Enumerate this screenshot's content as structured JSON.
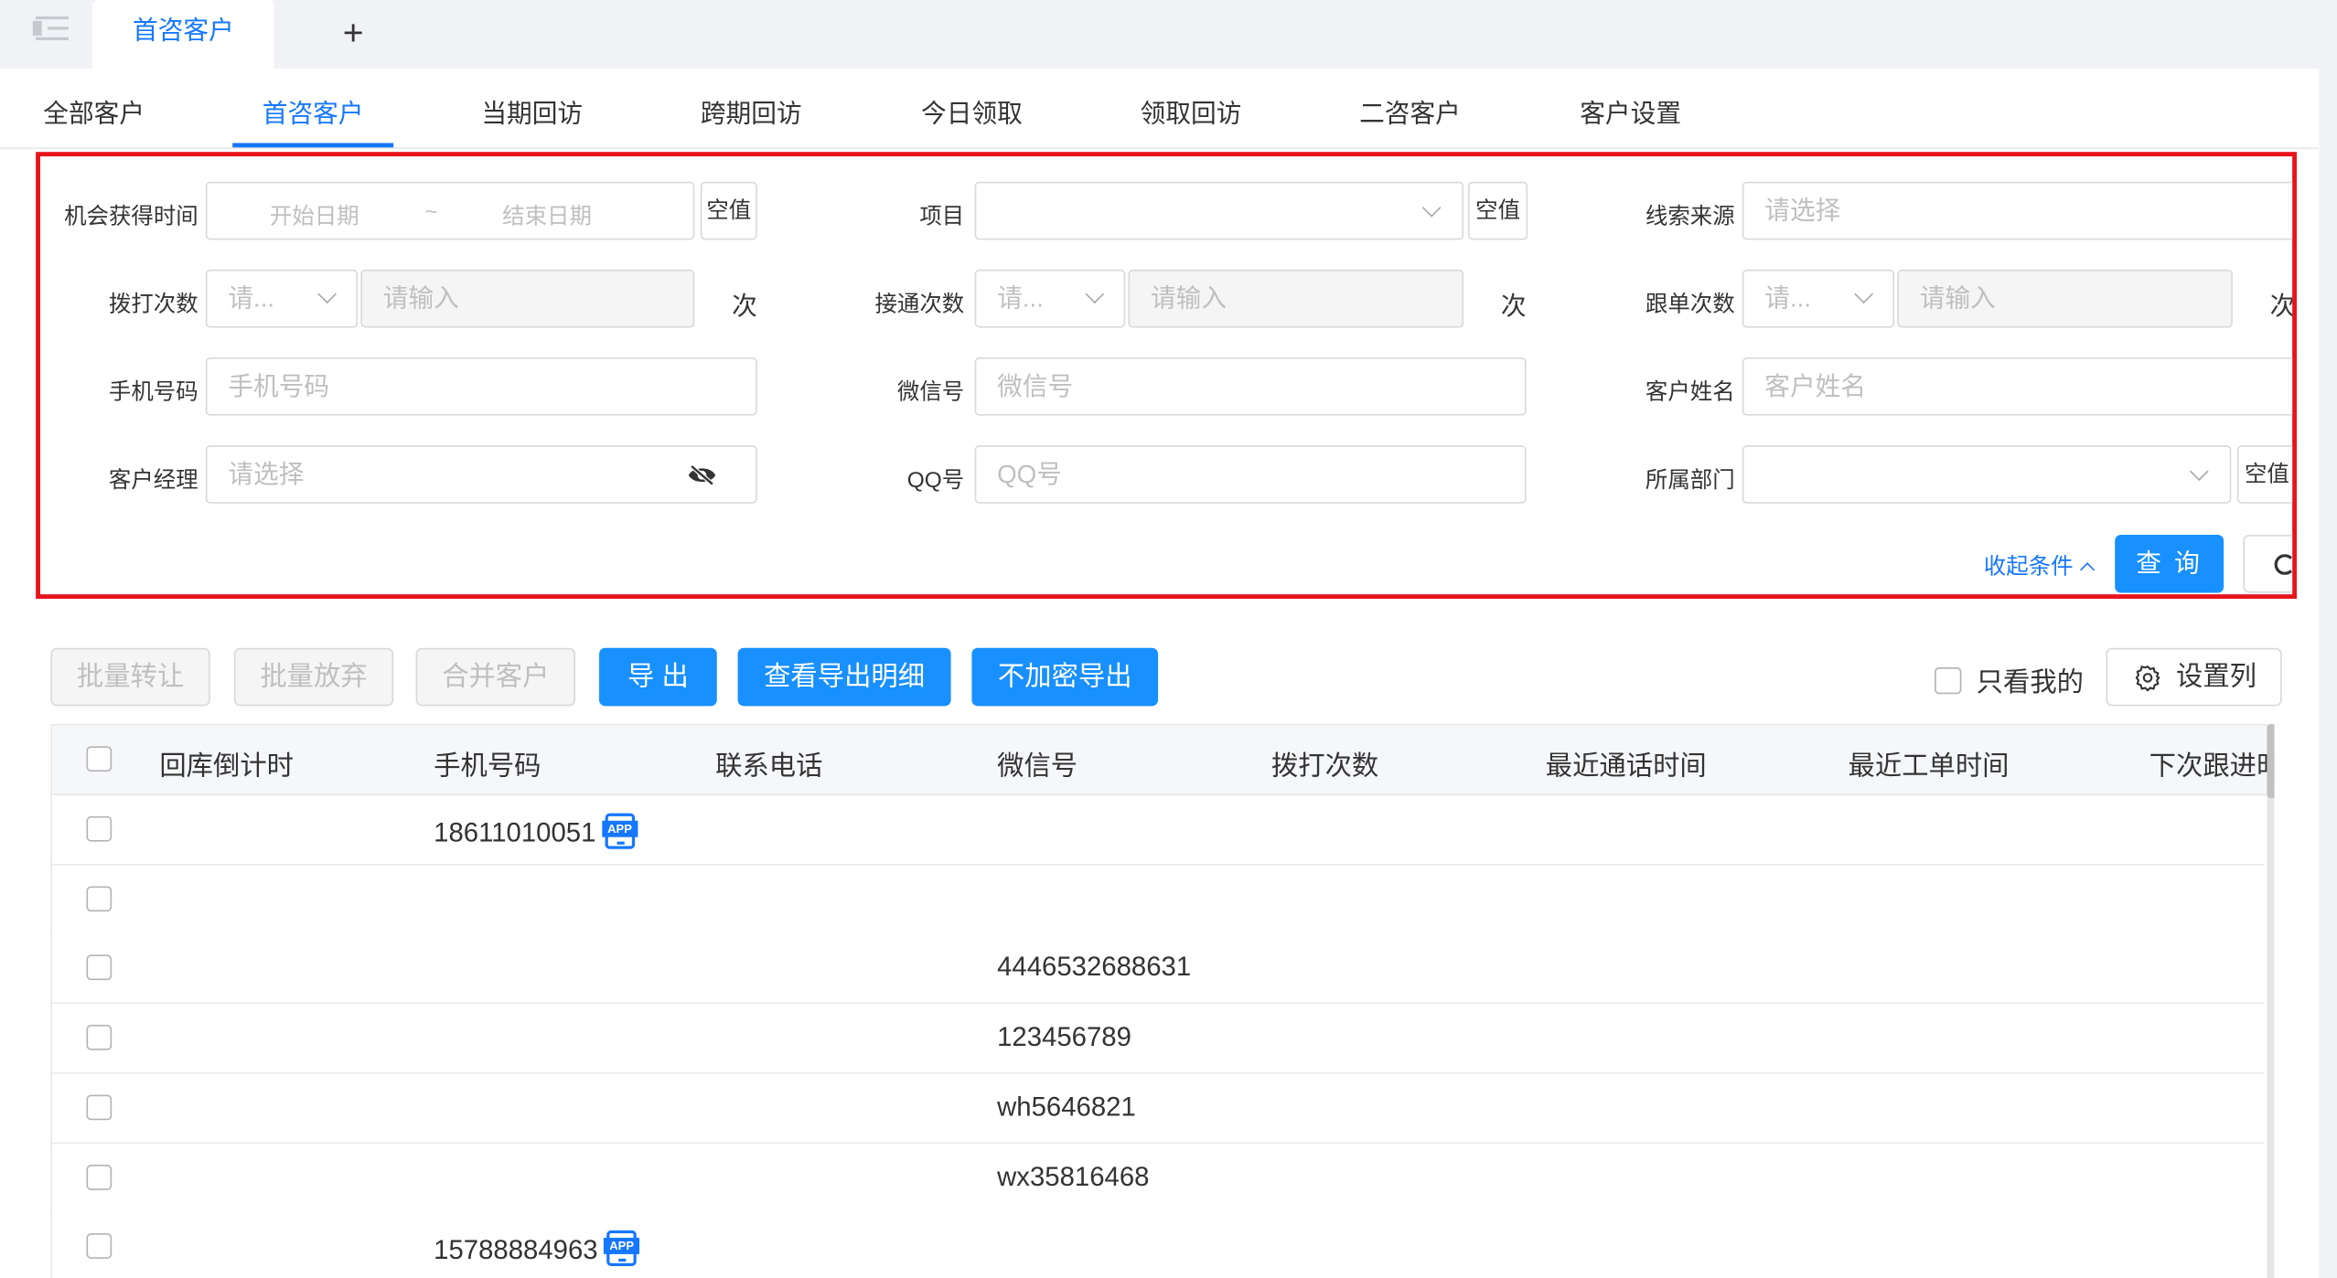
{
  "page_tabs": [
    {
      "label": "首咨客户"
    }
  ],
  "sub_tabs": [
    "全部客户",
    "首咨客户",
    "当期回访",
    "跨期回访",
    "今日领取",
    "领取回访",
    "二咨客户",
    "客户设置"
  ],
  "filters": {
    "opportunity_time": {
      "label": "机会获得时间",
      "start_placeholder": "开始日期",
      "separator": "~",
      "end_placeholder": "结束日期",
      "empty_btn": "空值"
    },
    "project": {
      "label": "项目",
      "value": "",
      "empty_btn": "空值"
    },
    "lead_source": {
      "label": "线索来源",
      "placeholder": "请选择"
    },
    "dial_count": {
      "label": "拨打次数",
      "op_placeholder": "请...",
      "placeholder": "请输入",
      "unit": "次"
    },
    "connect_count": {
      "label": "接通次数",
      "op_placeholder": "请...",
      "placeholder": "请输入",
      "unit": "次"
    },
    "follow_count": {
      "label": "跟单次数",
      "op_placeholder": "请...",
      "placeholder": "请输入",
      "unit": "次"
    },
    "phone": {
      "label": "手机号码",
      "placeholder": "手机号码"
    },
    "wechat": {
      "label": "微信号",
      "placeholder": "微信号"
    },
    "customer_name": {
      "label": "客户姓名",
      "placeholder": "客户姓名"
    },
    "manager": {
      "label": "客户经理",
      "placeholder": "请选择"
    },
    "qq": {
      "label": "QQ号",
      "placeholder": "QQ号"
    },
    "department": {
      "label": "所属部门",
      "value": "",
      "empty_btn": "空值"
    },
    "collapse_label": "收起条件",
    "query_label": "查 询"
  },
  "toolbar": {
    "batch_transfer": "批量转让",
    "batch_abandon": "批量放弃",
    "merge_customers": "合并客户",
    "export": "导 出",
    "view_export_detail": "查看导出明细",
    "export_unencrypted": "不加密导出",
    "only_mine": "只看我的",
    "set_columns": "设置列"
  },
  "table": {
    "columns": [
      "回库倒计时",
      "手机号码",
      "联系电话",
      "微信号",
      "拨打次数",
      "最近通话时间",
      "最近工单时间",
      "下次跟进时"
    ],
    "rows": [
      {
        "countdown": "",
        "phone": "18611010051",
        "phone_app": true,
        "tel": "",
        "wechat": "",
        "dial": "",
        "last_call": "",
        "last_ticket": "",
        "next_follow": ""
      },
      {
        "countdown": "",
        "phone": "",
        "phone_app": false,
        "tel": "",
        "wechat": "",
        "dial": "",
        "last_call": "",
        "last_ticket": "",
        "next_follow": ""
      },
      {
        "countdown": "",
        "phone": "",
        "phone_app": false,
        "tel": "",
        "wechat": "4446532688631",
        "dial": "",
        "last_call": "",
        "last_ticket": "",
        "next_follow": ""
      },
      {
        "countdown": "",
        "phone": "",
        "phone_app": false,
        "tel": "",
        "wechat": "123456789",
        "dial": "",
        "last_call": "",
        "last_ticket": "",
        "next_follow": ""
      },
      {
        "countdown": "",
        "phone": "",
        "phone_app": false,
        "tel": "",
        "wechat": "wh5646821",
        "dial": "",
        "last_call": "",
        "last_ticket": "",
        "next_follow": ""
      },
      {
        "countdown": "",
        "phone": "",
        "phone_app": false,
        "tel": "",
        "wechat": "wx35816468",
        "dial": "",
        "last_call": "",
        "last_ticket": "",
        "next_follow": ""
      },
      {
        "countdown": "",
        "phone": "15788884963",
        "phone_app": true,
        "tel": "",
        "wechat": "",
        "dial": "",
        "last_call": "",
        "last_ticket": "",
        "next_follow": ""
      }
    ],
    "app_badge": "APP"
  },
  "colors": {
    "accent": "#1890ff",
    "highlight_border": "#e8141d"
  }
}
